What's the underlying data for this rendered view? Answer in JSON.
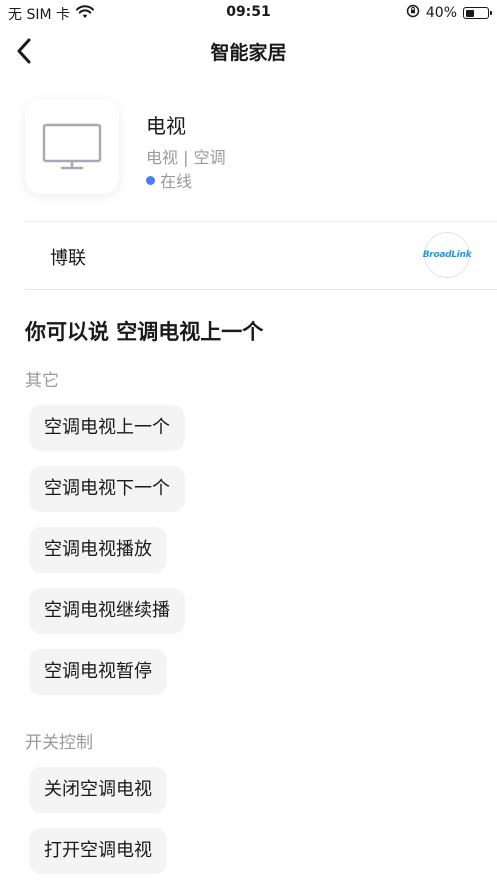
{
  "status_bar": {
    "carrier": "无 SIM 卡",
    "time": "09:51",
    "battery": "40%",
    "battery_level": 0.4
  },
  "nav": {
    "title": "智能家居"
  },
  "device": {
    "name": "电视",
    "types": "电视 | 空调",
    "status": "在线",
    "status_color": "#4a7cf6"
  },
  "brand": {
    "name": "博联",
    "logo_text": "BroadLink"
  },
  "say_heading": "你可以说 空调电视上一个",
  "sections": [
    {
      "title": "其它",
      "commands": [
        "空调电视上一个",
        "空调电视下一个",
        "空调电视播放",
        "空调电视继续播",
        "空调电视暂停"
      ]
    },
    {
      "title": "开关控制",
      "commands": [
        "关闭空调电视",
        "打开空调电视"
      ]
    }
  ]
}
